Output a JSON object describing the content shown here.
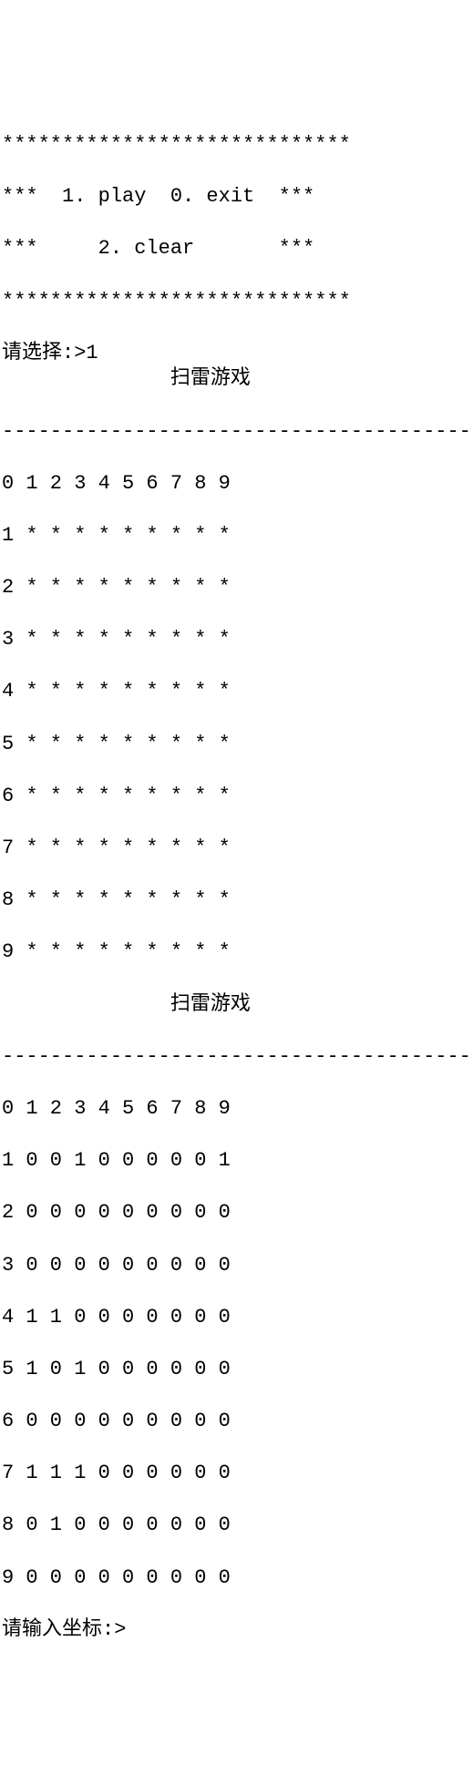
{
  "menu": {
    "border": "*****************************",
    "line1": "***  1. play  0. exit  ***",
    "line2": "***     2. clear       ***"
  },
  "prompt1": {
    "label": "请选择:>",
    "value": "1"
  },
  "game": {
    "title": "              扫雷游戏",
    "divider": "------------------------------------------",
    "board1": {
      "header": "0 1 2 3 4 5 6 7 8 9",
      "rows": [
        "1 * * * * * * * * *",
        "2 * * * * * * * * *",
        "3 * * * * * * * * *",
        "4 * * * * * * * * *",
        "5 * * * * * * * * *",
        "6 * * * * * * * * *",
        "7 * * * * * * * * *",
        "8 * * * * * * * * *",
        "9 * * * * * * * * *"
      ]
    },
    "board2": {
      "header": "0 1 2 3 4 5 6 7 8 9",
      "rows": [
        "1 0 0 1 0 0 0 0 0 1",
        "2 0 0 0 0 0 0 0 0 0",
        "3 0 0 0 0 0 0 0 0 0",
        "4 1 1 0 0 0 0 0 0 0",
        "5 1 0 1 0 0 0 0 0 0",
        "6 0 0 0 0 0 0 0 0 0",
        "7 1 1 1 0 0 0 0 0 0",
        "8 0 1 0 0 0 0 0 0 0",
        "9 0 0 0 0 0 0 0 0 0"
      ]
    }
  },
  "prompt2": {
    "label": "请输入坐标:>"
  }
}
